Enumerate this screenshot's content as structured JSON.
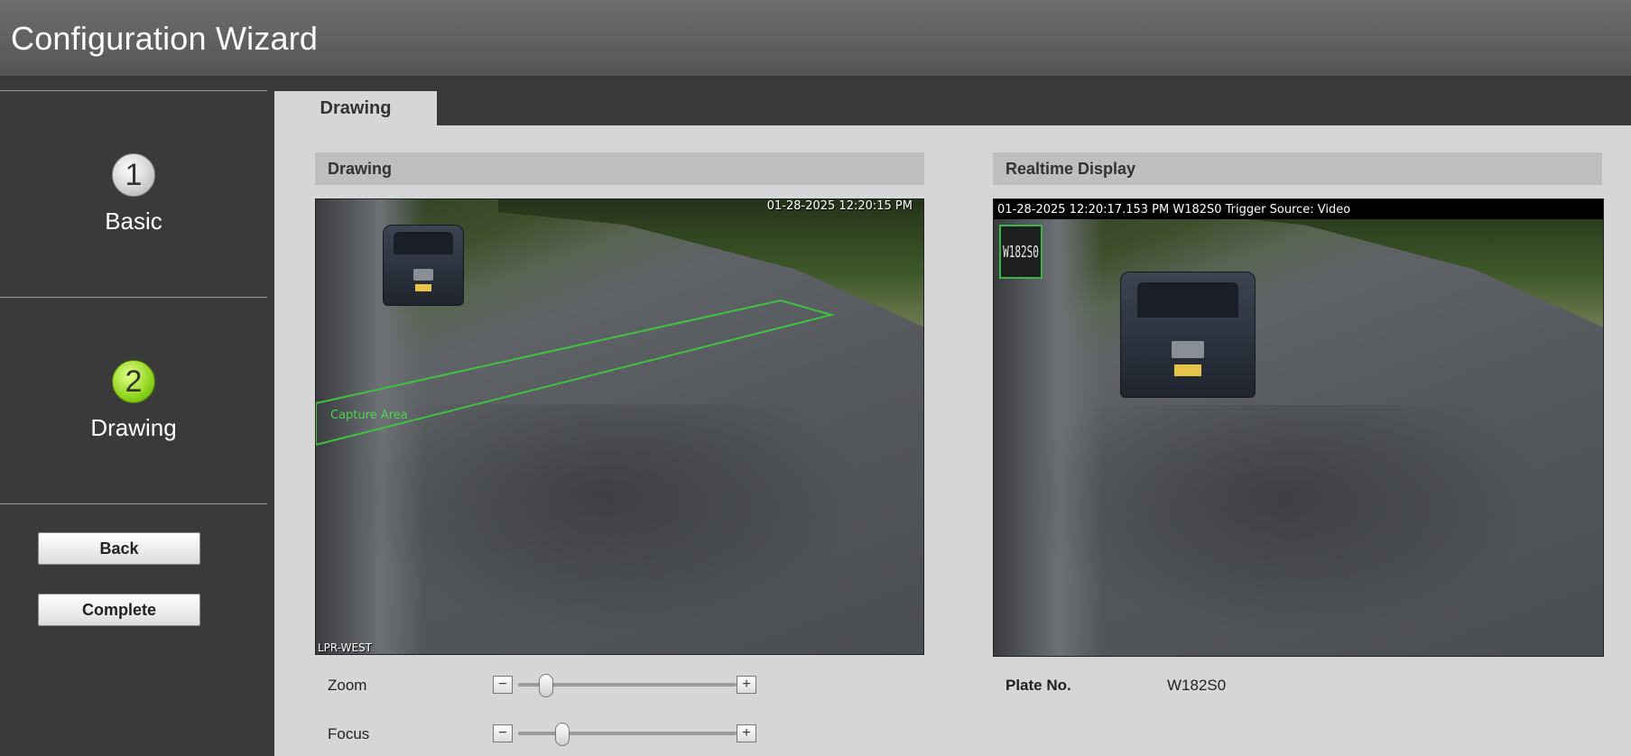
{
  "window": {
    "title": "Configuration Wizard"
  },
  "steps": [
    {
      "number": "1",
      "label": "Basic",
      "state": "inactive"
    },
    {
      "number": "2",
      "label": "Drawing",
      "state": "active"
    }
  ],
  "nav": {
    "back_label": "Back",
    "complete_label": "Complete"
  },
  "tabs": [
    {
      "label": "Drawing",
      "active": true
    }
  ],
  "drawing_panel": {
    "header": "Drawing",
    "video_timestamp": "01-28-2025 12:20:15 PM",
    "channel_label": "LPR-WEST",
    "capture_area_label": "Capture Area",
    "capture_area_color": "#3fc23f"
  },
  "realtime_panel": {
    "header": "Realtime Display",
    "osd_text": "01-28-2025 12:20:17.153 PM W182S0 Trigger Source: Video",
    "plate_thumb_text": "W182S0"
  },
  "controls": {
    "zoom": {
      "label": "Zoom",
      "minus": "−",
      "plus": "+",
      "value": 0.1
    },
    "focus": {
      "label": "Focus",
      "minus": "−",
      "plus": "+",
      "value": 0.18
    }
  },
  "plate": {
    "label": "Plate No.",
    "value": "W182S0"
  },
  "colors": {
    "titlebar": "#5e5e5e",
    "sidebar": "#3a3a3a",
    "content_bg": "#d6d6d6",
    "active_step": "#8fd41c"
  }
}
